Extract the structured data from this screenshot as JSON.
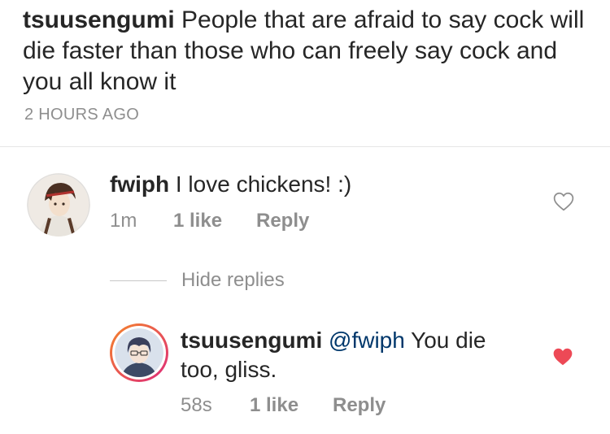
{
  "post": {
    "username": "tsuusengumi",
    "caption": "People that are afraid to say cock will die faster than those who can freely say cock and you all know it",
    "timestamp": "2 HOURS AGO"
  },
  "comments": [
    {
      "username": "fwiph",
      "text": "I love chickens! :)",
      "time": "1m",
      "likes": "1 like",
      "reply_label": "Reply",
      "liked": false,
      "avatar_icon": "anime-character-avatar"
    }
  ],
  "replies_toggle": "Hide replies",
  "replies": [
    {
      "username": "tsuusengumi",
      "mention": "@fwiph",
      "text": "You die too, gliss.",
      "time": "58s",
      "likes": "1 like",
      "reply_label": "Reply",
      "liked": true,
      "avatar_icon": "anime-character-avatar-story-ring"
    }
  ],
  "colors": {
    "heart_liked": "#ed4956",
    "mention": "#00376b",
    "secondary_text": "#8e8e8e",
    "story_ring_start": "#f58529",
    "story_ring_end": "#dd2a7b"
  }
}
